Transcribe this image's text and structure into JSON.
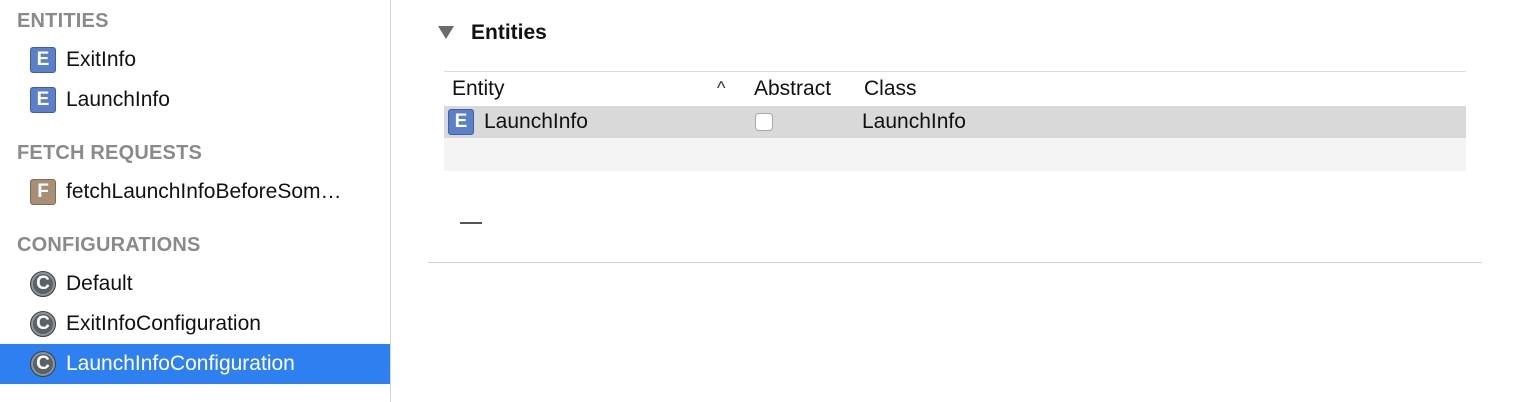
{
  "sidebar": {
    "sections": {
      "entities": "ENTITIES",
      "fetch_requests": "FETCH REQUESTS",
      "configurations": "CONFIGURATIONS"
    },
    "entities": [
      {
        "icon_letter": "E",
        "label": "ExitInfo"
      },
      {
        "icon_letter": "E",
        "label": "LaunchInfo"
      }
    ],
    "fetch_requests": [
      {
        "icon_letter": "F",
        "label": "fetchLaunchInfoBeforeSom…"
      }
    ],
    "configurations": [
      {
        "icon_letter": "C",
        "label": "Default"
      },
      {
        "icon_letter": "C",
        "label": "ExitInfoConfiguration"
      },
      {
        "icon_letter": "C",
        "label": "LaunchInfoConfiguration",
        "selected": true
      }
    ],
    "selection_color": "#2e80f0"
  },
  "main": {
    "section_title": "Entities",
    "table": {
      "columns": [
        "Entity",
        "Abstract",
        "Class"
      ],
      "sort_indicator": "^",
      "rows": [
        {
          "icon_letter": "E",
          "entity": "LaunchInfo",
          "abstract": false,
          "class": "LaunchInfo"
        }
      ]
    },
    "remove_button": "—"
  }
}
